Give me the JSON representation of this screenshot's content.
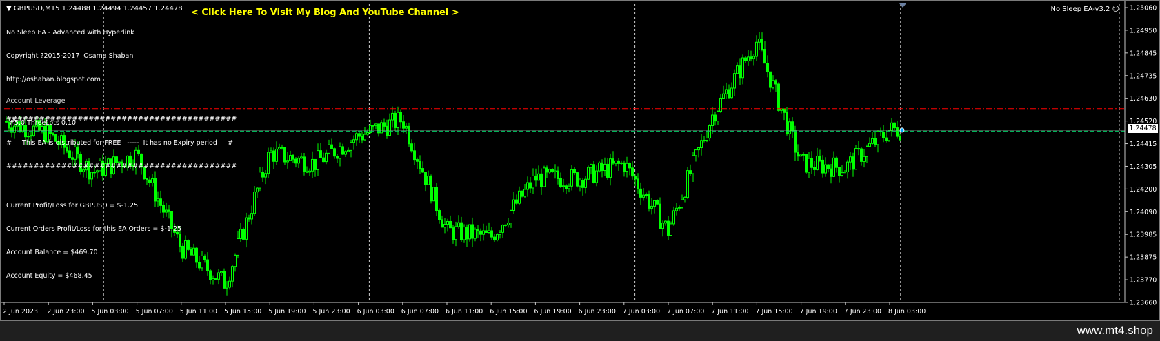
{
  "header": {
    "symbol_line": "GBPUSD,M15  1.24488 1.24494 1.24457 1.24478",
    "blog_link": "< Click Here To Visit My Blog And YouTube Channel >",
    "ea_badge": "No Sleep EA-v3.2"
  },
  "info_lines": [
    "No Sleep EA - Advanced with Hyperlink",
    "Copyright ?2015-2017  Osama Shaban",
    "http://oshaban.blogspot.com",
    "",
    "##########################################",
    "#     This EA is distributed for FREE   -----  It has no Expiry period     #",
    "##########################################",
    "",
    "Current Profit/Loss for GBPUSD = $-1.25",
    "Current Orders Profit/Loss for this EA Orders = $-1.25",
    "Account Balance = $469.70",
    "Account Equity = $468.45"
  ],
  "overlaps": {
    "account_overlap": "Account Leverage",
    "lots_overlap": "#5.0 ThreeLots 0.10"
  },
  "price_axis": {
    "ticks": [
      "1.25060",
      "1.24950",
      "1.24845",
      "1.24735",
      "1.24630",
      "1.24520",
      "1.24415",
      "1.24305",
      "1.24200",
      "1.24090",
      "1.23985",
      "1.23875",
      "1.23770",
      "1.23660"
    ],
    "current_price": "1.24478"
  },
  "time_axis": {
    "labels": [
      "2 Jun 2023",
      "2 Jun 23:00",
      "5 Jun 03:00",
      "5 Jun 07:00",
      "5 Jun 11:00",
      "5 Jun 15:00",
      "5 Jun 19:00",
      "5 Jun 23:00",
      "6 Jun 03:00",
      "6 Jun 07:00",
      "6 Jun 11:00",
      "6 Jun 15:00",
      "6 Jun 19:00",
      "6 Jun 23:00",
      "7 Jun 03:00",
      "7 Jun 07:00",
      "7 Jun 11:00",
      "7 Jun 15:00",
      "7 Jun 19:00",
      "7 Jun 23:00",
      "8 Jun 03:00"
    ]
  },
  "colors": {
    "background": "#000000",
    "candle": "#00ff00",
    "text": "#ffffff",
    "link": "#ffff00",
    "resistance_line": "#ff0000",
    "bid_line": "#a0a0a0"
  },
  "footer": {
    "site": "www.mt4.shop"
  },
  "chart_data": {
    "type": "line",
    "x": [
      "2 Jun 2023",
      "2 Jun 23:00",
      "5 Jun 03:00",
      "5 Jun 07:00",
      "5 Jun 11:00",
      "5 Jun 15:00",
      "5 Jun 19:00",
      "5 Jun 23:00",
      "6 Jun 03:00",
      "6 Jun 07:00",
      "6 Jun 11:00",
      "6 Jun 15:00",
      "6 Jun 19:00",
      "6 Jun 23:00",
      "7 Jun 03:00",
      "7 Jun 07:00",
      "7 Jun 11:00",
      "7 Jun 15:00",
      "7 Jun 19:00",
      "7 Jun 23:00",
      "8 Jun 03:00"
    ],
    "series": [
      {
        "values": [
          1.2452,
          1.2446,
          1.2428,
          1.2436,
          1.2392,
          1.2375,
          1.2437,
          1.2432,
          1.2445,
          1.2453,
          1.24,
          1.2397,
          1.2425,
          1.2425,
          1.2432,
          1.24,
          1.2455,
          1.249,
          1.2432,
          1.243,
          1.2448
        ]
      }
    ],
    "levels": {
      "resistance": 1.2458,
      "bid": 1.24478
    },
    "ylim": [
      1.2366,
      1.2506
    ],
    "grid": "vertical dashed"
  }
}
